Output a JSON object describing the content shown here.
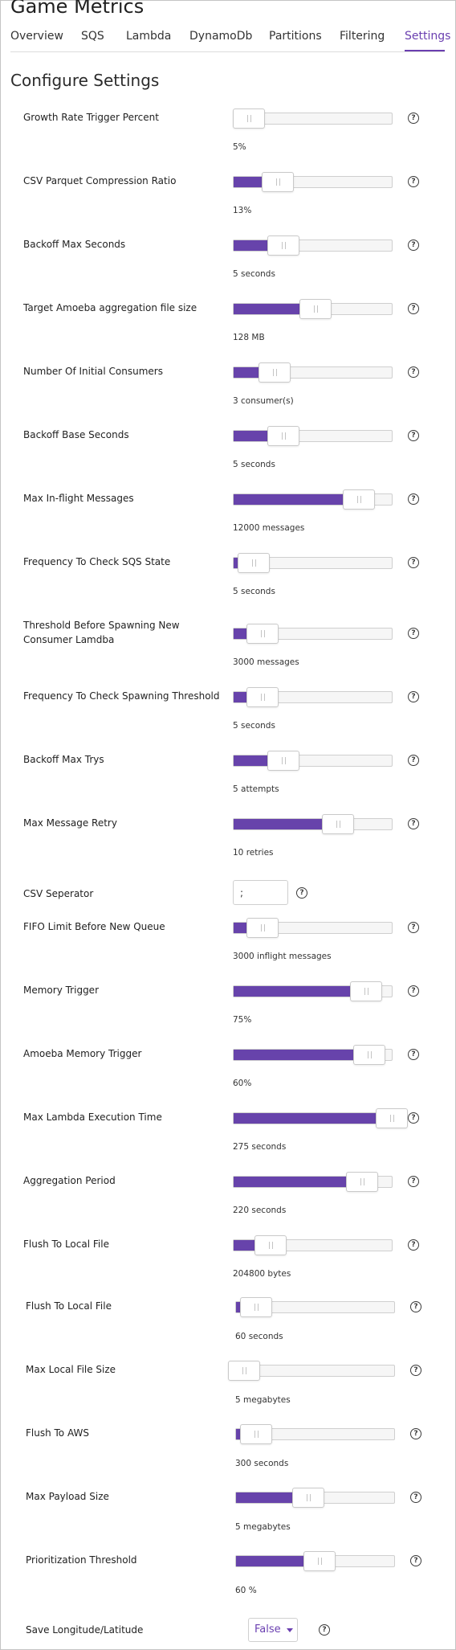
{
  "app": {
    "title": "Game Metrics"
  },
  "tabs": [
    {
      "label": "Overview"
    },
    {
      "label": "SQS"
    },
    {
      "label": "Lambda"
    },
    {
      "label": "DynamoDb"
    },
    {
      "label": "Partitions"
    },
    {
      "label": "Filtering"
    },
    {
      "label": "Settings",
      "active": true
    }
  ],
  "section_title": "Configure Settings",
  "help_icon_glyph": "?",
  "accent_color": "#6743ab",
  "settings": [
    {
      "label": "Growth Rate Trigger Percent",
      "value_text": "5%",
      "level": 0.05
    },
    {
      "label": "CSV Parquet Compression Ratio",
      "value_text": "13%",
      "level": 0.24
    },
    {
      "label": "Backoff Max Seconds",
      "value_text": "5 seconds",
      "level": 0.28
    },
    {
      "label": "Target Amoeba aggregation file size",
      "value_text": "128 MB",
      "level": 0.49
    },
    {
      "label": "Number Of Initial Consumers",
      "value_text": "3 consumer(s)",
      "level": 0.22
    },
    {
      "label": "Backoff Base Seconds",
      "value_text": "5 seconds",
      "level": 0.28
    },
    {
      "label": "Max In-flight Messages",
      "value_text": "12000 messages",
      "level": 0.78
    },
    {
      "label": "Frequency To Check SQS State",
      "value_text": "5 seconds",
      "level": 0.08
    },
    {
      "label": "Threshold Before Spawning New Consumer Lamdba",
      "value_text": "3000 messages",
      "level": 0.14
    },
    {
      "label": "Frequency To Check Spawning Threshold",
      "value_text": "5 seconds",
      "level": 0.14
    },
    {
      "label": "Backoff Max Trys",
      "value_text": "5 attempts",
      "level": 0.28
    },
    {
      "label": "Max Message Retry",
      "value_text": "10 retries",
      "level": 0.64
    },
    {
      "label": "FIFO Limit Before New Queue",
      "value_text": "3000 inflight messages",
      "level": 0.14
    },
    {
      "label": "Memory Trigger",
      "value_text": "75%",
      "level": 0.83
    },
    {
      "label": "Amoeba Memory Trigger",
      "value_text": "60%",
      "level": 0.85
    },
    {
      "label": "Max Lambda Execution Time",
      "value_text": "275 seconds",
      "level": 1.0
    },
    {
      "label": "Aggregation Period",
      "value_text": "220 seconds",
      "level": 0.8
    },
    {
      "label": "Flush To Local File",
      "value_text": "204800 bytes",
      "level": 0.19
    },
    {
      "label": "Flush To Local File",
      "value_text": "60 seconds",
      "level": 0.08
    },
    {
      "label": "Max Local File Size",
      "value_text": "5 megabytes",
      "level": 0.0
    },
    {
      "label": "Flush To AWS",
      "value_text": "300 seconds",
      "level": 0.08
    },
    {
      "label": "Max Payload Size",
      "value_text": "5 megabytes",
      "level": 0.43
    },
    {
      "label": "Prioritization Threshold",
      "value_text": "60 %",
      "level": 0.5
    }
  ],
  "csv_separator": {
    "label": "CSV Seperator",
    "value": ";"
  },
  "save_lon_lat": {
    "label": "Save Longitude/Latitude",
    "selected": "False"
  }
}
